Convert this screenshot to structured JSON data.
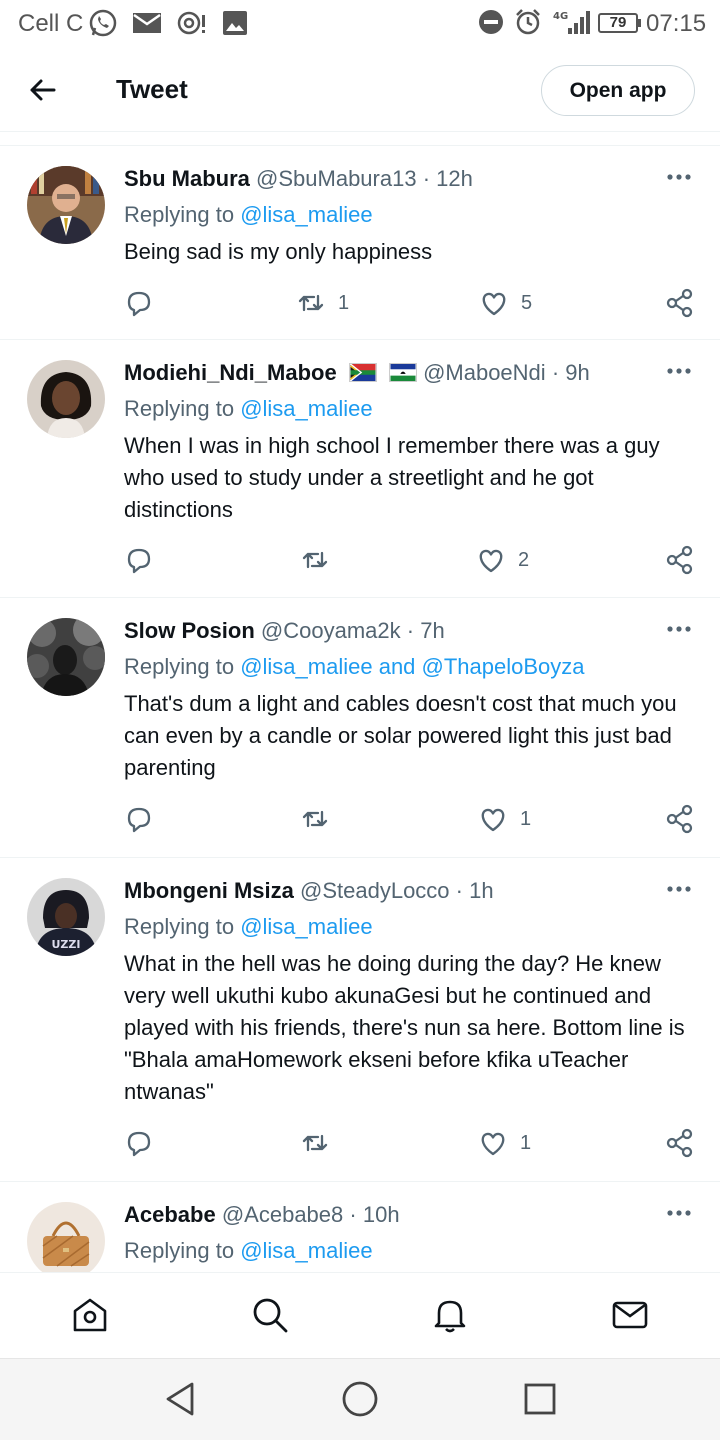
{
  "status_bar": {
    "carrier": "Cell C",
    "battery": "79",
    "network": "4G",
    "time": "07:15"
  },
  "header": {
    "title": "Tweet",
    "open_app_label": "Open app"
  },
  "tweets": [
    {
      "name": "Sbu Mabura",
      "handle": "@SbuMabura13",
      "time": "12h",
      "replying_label": "Replying to",
      "replying_to": "@lisa_maliee",
      "text": "Being sad is my only happiness",
      "retweets": "1",
      "likes": "5"
    },
    {
      "name": "Modiehi_Ndi_Maboe",
      "handle": "@MaboeNdi",
      "time": "9h",
      "flags": [
        "south-africa-flag",
        "lesotho-flag"
      ],
      "replying_label": "Replying to",
      "replying_to": "@lisa_maliee",
      "text": "When I was in high school I remember there was a guy who used to study under a streetlight and he got distinctions",
      "retweets": "",
      "likes": "2"
    },
    {
      "name": "Slow Posion",
      "handle": "@Cooyama2k",
      "time": "7h",
      "replying_label": "Replying to",
      "replying_to": "@lisa_maliee and @ThapeloBoyza",
      "text": "That's dum a light and cables doesn't cost that much you can even by a candle or solar powered light this just bad parenting",
      "retweets": "",
      "likes": "1"
    },
    {
      "name": "Mbongeni Msiza",
      "handle": "@SteadyLocco",
      "time": "1h",
      "replying_label": "Replying to",
      "replying_to": "@lisa_maliee",
      "text": "What in the hell was he doing during the day? He knew very well ukuthi kubo akunaGesi but he continued and played with his friends, there's nun sa here. Bottom line is \"Bhala amaHomework ekseni before kfika uTeacher ntwanas\"",
      "retweets": "",
      "likes": "1",
      "avatar_text": "UZZI"
    },
    {
      "name": "Acebabe",
      "handle": "@Acebabe8",
      "time": "10h",
      "replying_label": "Replying to",
      "replying_to": "@lisa_maliee",
      "text": "",
      "retweets": "",
      "likes": ""
    }
  ],
  "tab_bar": [
    "home-icon",
    "search-icon",
    "notifications-icon",
    "messages-icon"
  ],
  "nav_bar": [
    "back-triangle-icon",
    "home-circle-icon",
    "recents-square-icon"
  ],
  "colors": {
    "link": "#1d9bf0",
    "secondary_text": "#536471",
    "primary_text": "#0f1419",
    "divider": "#eff3f4"
  }
}
